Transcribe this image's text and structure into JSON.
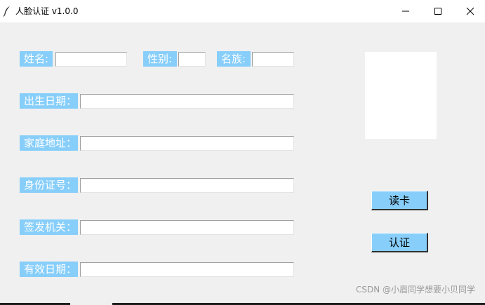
{
  "window": {
    "title": "人脸认证 v1.0.0",
    "icon": "feather-icon"
  },
  "form": {
    "name_label": "姓名:",
    "gender_label": "性别:",
    "ethnicity_label": "名族:",
    "birthdate_label": "出生日期：",
    "address_label": "家庭地址：",
    "id_number_label": "身份证号：",
    "issuer_label": "签发机关：",
    "valid_date_label": "有效日期：",
    "values": {
      "name": "",
      "gender": "",
      "ethnicity": "",
      "birthdate": "",
      "address": "",
      "id_number": "",
      "issuer": "",
      "valid_date": ""
    }
  },
  "buttons": {
    "read_card": "读卡",
    "verify": "认证"
  },
  "watermark": "CSDN @小眉同学想要小贝同学",
  "colors": {
    "label_bg": "#87cefa",
    "window_bg": "#f0f0f0"
  }
}
